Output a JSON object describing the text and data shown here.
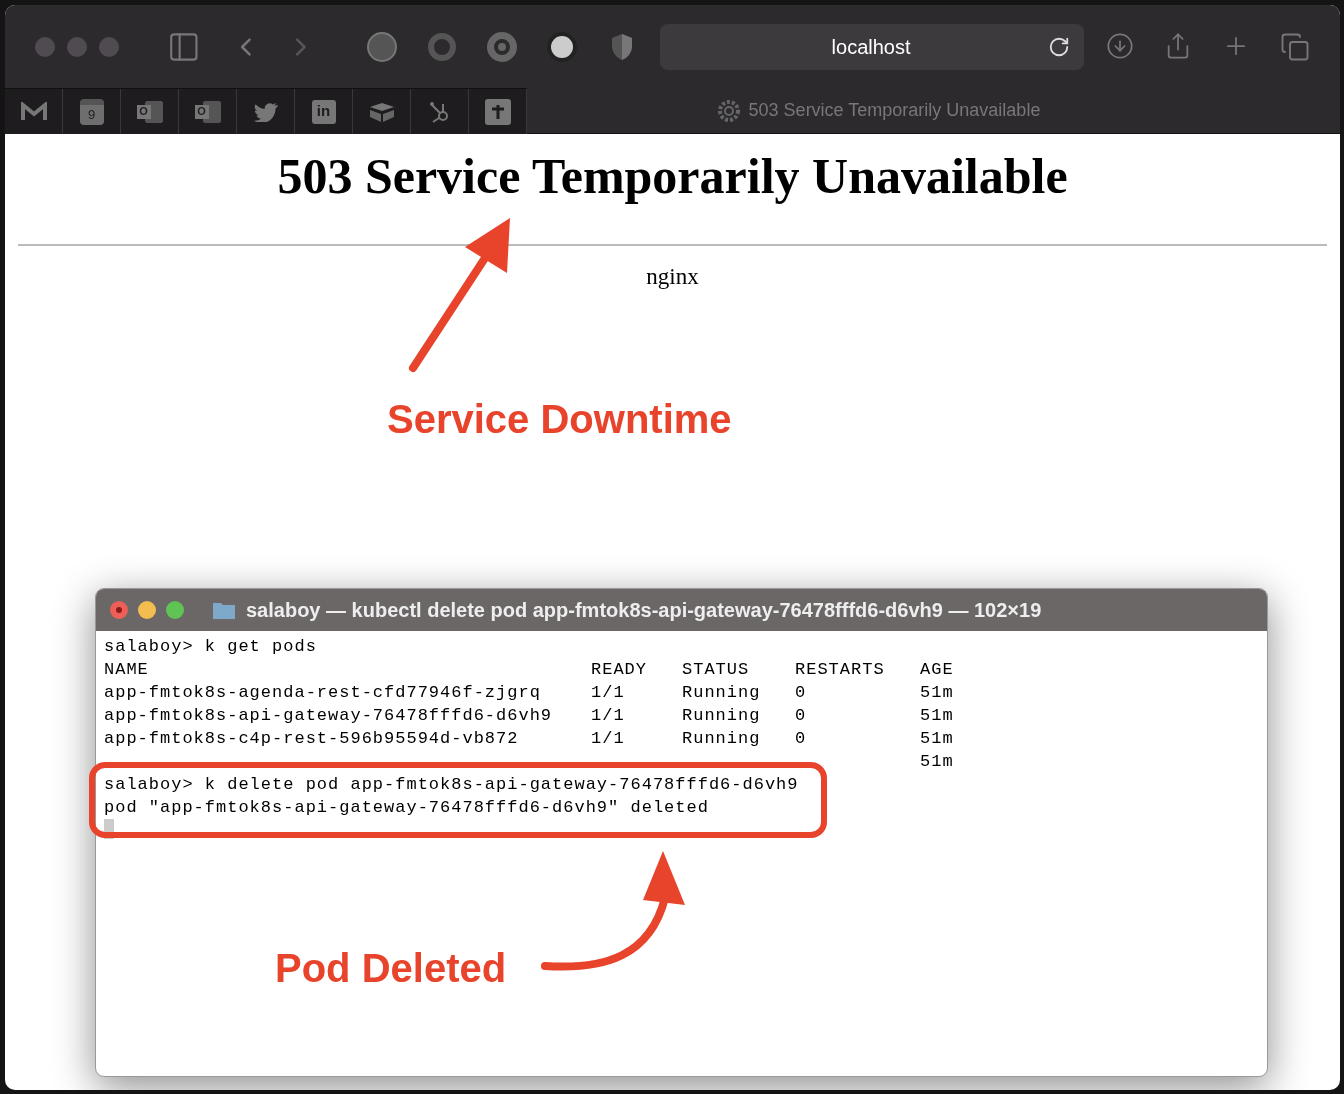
{
  "browser": {
    "address": "localhost",
    "tab_title": "503 Service Temporarily Unavailable",
    "bookmarks": [
      {
        "kind": "mail"
      },
      {
        "kind": "calendar",
        "text": "9"
      },
      {
        "kind": "outlook",
        "text": "O"
      },
      {
        "kind": "outlook",
        "text": "O"
      },
      {
        "kind": "bird"
      },
      {
        "kind": "linkedin",
        "text": "in"
      },
      {
        "kind": "box"
      },
      {
        "kind": "hub"
      },
      {
        "kind": "plus"
      }
    ]
  },
  "page": {
    "heading": "503 Service Temporarily Unavailable",
    "server": "nginx"
  },
  "annotations": {
    "top": "Service Downtime",
    "bottom": "Pod Deleted"
  },
  "terminal": {
    "title": "salaboy — kubectl delete pod app-fmtok8s-api-gateway-76478fffd6-d6vh9 — 102×19",
    "command_1": "salaboy> k get pods",
    "columns": [
      "NAME",
      "READY",
      "STATUS",
      "RESTARTS",
      "AGE"
    ],
    "rows": [
      {
        "name": "app-fmtok8s-agenda-rest-cfd77946f-zjgrq",
        "ready": "1/1",
        "status": "Running",
        "restarts": "0",
        "age": "51m"
      },
      {
        "name": "app-fmtok8s-api-gateway-76478fffd6-d6vh9",
        "ready": "1/1",
        "status": "Running",
        "restarts": "0",
        "age": "51m"
      },
      {
        "name": "app-fmtok8s-c4p-rest-596b95594d-vb872",
        "ready": "1/1",
        "status": "Running",
        "restarts": "0",
        "age": "51m"
      },
      {
        "age": "51m"
      }
    ],
    "command_2": "salaboy> k delete pod app-fmtok8s-api-gateway-76478fffd6-d6vh9",
    "output": "pod \"app-fmtok8s-api-gateway-76478fffd6-d6vh9\" deleted"
  }
}
